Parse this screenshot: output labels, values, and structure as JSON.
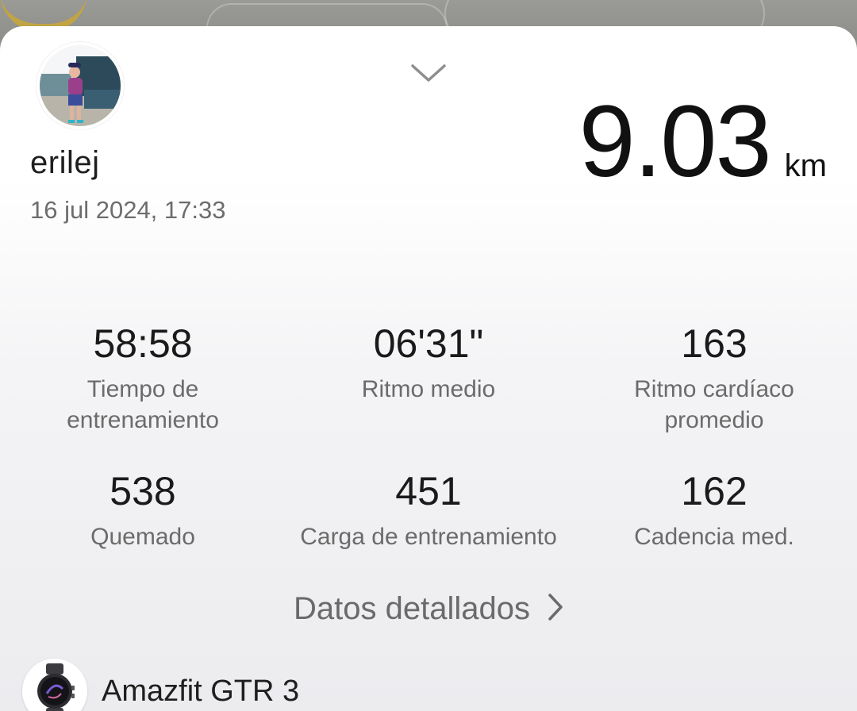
{
  "header": {
    "username": "erilej",
    "datetime": "16 jul 2024, 17:33"
  },
  "distance": {
    "value": "9.03",
    "unit": "km"
  },
  "stats": [
    {
      "value": "58:58",
      "label": "Tiempo de\nentrenamiento"
    },
    {
      "value": "06'31\"",
      "label": "Ritmo medio"
    },
    {
      "value": "163",
      "label": "Ritmo cardíaco\npromedio"
    },
    {
      "value": "538",
      "label": "Quemado"
    },
    {
      "value": "451",
      "label": "Carga de entrenamiento"
    },
    {
      "value": "162",
      "label": "Cadencia med."
    }
  ],
  "details_link": "Datos detallados",
  "device": {
    "name": "Amazfit GTR 3"
  },
  "icons": {
    "collapse": "chevron-down-icon",
    "details": "chevron-right-icon",
    "device": "watch-icon"
  }
}
